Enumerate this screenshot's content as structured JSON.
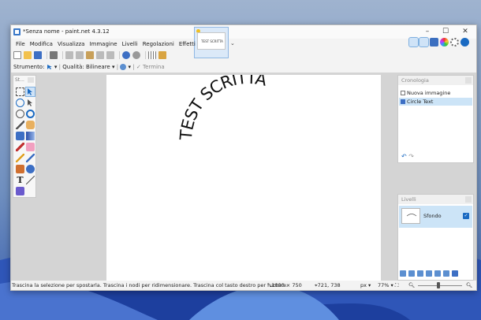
{
  "window": {
    "title": "*Senza nome - paint.net 4.3.12",
    "controls": {
      "minimize": "–",
      "maximize": "☐",
      "close": "✕"
    }
  },
  "menu": [
    "File",
    "Modifica",
    "Visualizza",
    "Immagine",
    "Livelli",
    "Regolazioni",
    "Effetti"
  ],
  "thumbnail": {
    "text": "TEST SCRITTA"
  },
  "toolbar2": {
    "tool_label": "Strumento:",
    "quality_label": "Qualità:",
    "quality_value": "Bilineare",
    "finish_label": "Termina"
  },
  "canvas": {
    "art_text": "TEST SCRITTA"
  },
  "tools_panel": {
    "title": "St..."
  },
  "history": {
    "title": "Cronologia",
    "items": [
      "Nuova immagine",
      "Circle Text"
    ],
    "selected_index": 1
  },
  "layers": {
    "title": "Livelli",
    "items": [
      {
        "name": "Sfondo",
        "visible": true
      }
    ]
  },
  "status": {
    "hint": "Trascina la selezione per spostarla. Trascina i nodi per ridimensionare. Trascina col tasto destro per ruotare.",
    "image_size": "1000 × 750",
    "cursor_pos": "721, 738",
    "unit": "px",
    "zoom": "77%"
  },
  "colors": {
    "accent": "#1a6ac2",
    "selection": "#cce4f7",
    "canvas": "#ffffff",
    "workspace": "#d4d4d4"
  },
  "icons": {
    "topright": [
      "tools-window-icon",
      "history-window-icon",
      "layers-window-icon",
      "colors-window-icon",
      "settings-icon",
      "help-icon"
    ],
    "toolbar1": [
      "new-icon",
      "open-icon",
      "save-icon",
      "print-icon",
      "cut-icon",
      "copy-icon",
      "paste-icon",
      "crop-icon",
      "deselect-icon",
      "undo-icon",
      "redo-icon",
      "grid-icon",
      "ruler-icon"
    ]
  }
}
